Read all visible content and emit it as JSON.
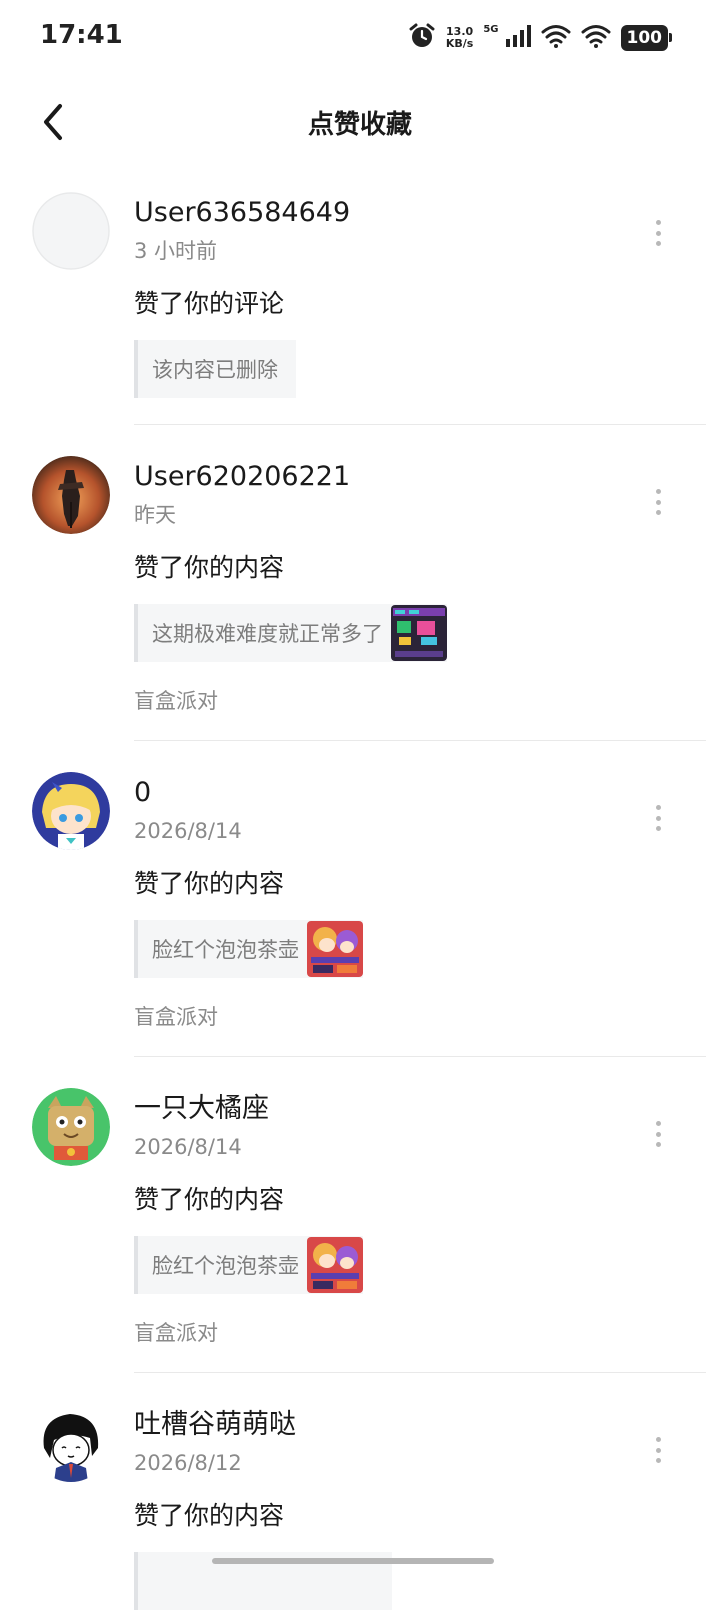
{
  "status_bar": {
    "time": "17:41",
    "speed_value": "13.0",
    "speed_unit": "KB/s",
    "network": "5G",
    "battery": "100"
  },
  "header": {
    "title": "点赞收藏"
  },
  "notifications": [
    {
      "username": "User636584649",
      "time": "3 小时前",
      "action": "赞了你的评论",
      "quote": "该内容已删除",
      "tag": "",
      "avatar_icon": "blank-avatar-icon"
    },
    {
      "username": "User620206221",
      "time": "昨天",
      "action": "赞了你的内容",
      "quote": "这期极难难度就正常多了",
      "tag": "盲盒派对",
      "avatar_icon": "warrior-sunset-avatar-icon"
    },
    {
      "username": "0",
      "time": "2026/8/14",
      "action": "赞了你的内容",
      "quote": "脸红个泡泡茶壶",
      "tag": "盲盒派对",
      "avatar_icon": "anime-girl-avatar-icon"
    },
    {
      "username": "一只大橘座",
      "time": "2026/8/14",
      "action": "赞了你的内容",
      "quote": "脸红个泡泡茶壶",
      "tag": "盲盒派对",
      "avatar_icon": "cat-avatar-icon"
    },
    {
      "username": "吐槽谷萌萌哒",
      "time": "2026/8/12",
      "action": "赞了你的内容",
      "quote": "",
      "tag": "",
      "avatar_icon": "sketch-character-avatar-icon"
    }
  ]
}
